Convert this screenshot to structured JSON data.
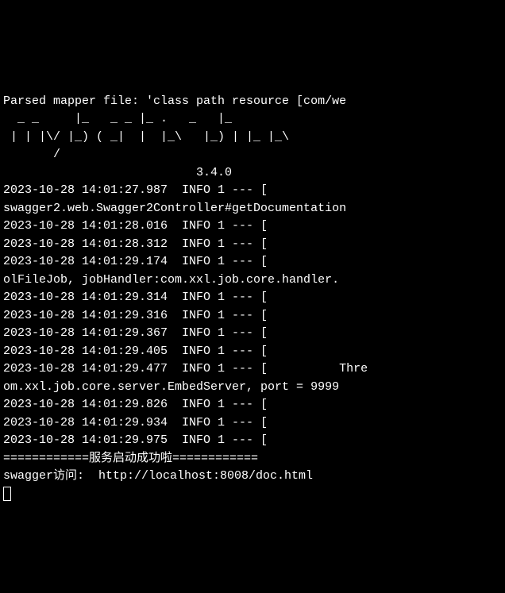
{
  "terminal": {
    "parsed_line": "Parsed mapper file: 'class path resource [com/we",
    "ascii_art": [
      "  _ _     |_   _ _ |_ .   _   |_",
      " | | |\\/ |_) ( _|  |  |_\\   |_) | |_ |_\\",
      "       /",
      "                           3.4.0"
    ],
    "log_entries": [
      "2023-10-28 14:01:27.987  INFO 1 --- [",
      "swagger2.web.Swagger2Controller#getDocumentation",
      "2023-10-28 14:01:28.016  INFO 1 --- [",
      "2023-10-28 14:01:28.312  INFO 1 --- [",
      "2023-10-28 14:01:29.174  INFO 1 --- [",
      "olFileJob, jobHandler:com.xxl.job.core.handler.",
      "2023-10-28 14:01:29.314  INFO 1 --- [",
      "2023-10-28 14:01:29.316  INFO 1 --- [",
      "2023-10-28 14:01:29.367  INFO 1 --- [",
      "2023-10-28 14:01:29.405  INFO 1 --- [",
      "2023-10-28 14:01:29.477  INFO 1 --- [          Thre",
      "om.xxl.job.core.server.EmbedServer, port = 9999",
      "2023-10-28 14:01:29.826  INFO 1 --- [",
      "2023-10-28 14:01:29.934  INFO 1 --- [",
      "2023-10-28 14:01:29.975  INFO 1 --- ["
    ],
    "success_line": "============服务启动成功啦============",
    "swagger_line": "swagger访问:  http://localhost:8008/doc.html"
  }
}
